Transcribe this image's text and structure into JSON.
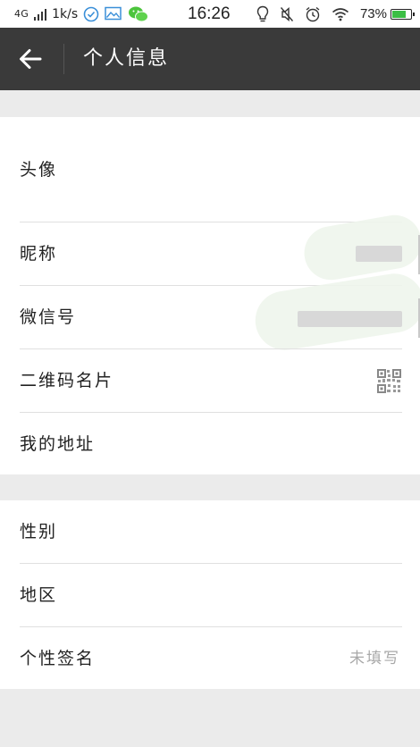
{
  "status_bar": {
    "network": "4G",
    "speed": "1k/s",
    "time": "16:26",
    "battery": "73%",
    "battery_level": 0.73,
    "battery_color": "#3cbf45",
    "left_icons": [
      "signal-icon",
      "check-circle-icon",
      "image-icon",
      "wechat-icon"
    ],
    "right_icons": [
      "lightbulb-icon",
      "mute-icon",
      "alarm-icon",
      "wifi-icon",
      "battery-icon"
    ]
  },
  "header": {
    "title": "个人信息",
    "back_icon": "arrow-left-icon",
    "background": "#3a3a3a"
  },
  "group1": {
    "avatar_label": "头像",
    "nickname_label": "昵称",
    "wechat_id_label": "微信号",
    "qrcode_label": "二维码名片",
    "qrcode_icon": "qr-code-icon",
    "address_label": "我的地址"
  },
  "group2": {
    "gender_label": "性别",
    "region_label": "地区",
    "signature_label": "个性签名",
    "signature_value": "未填写"
  }
}
